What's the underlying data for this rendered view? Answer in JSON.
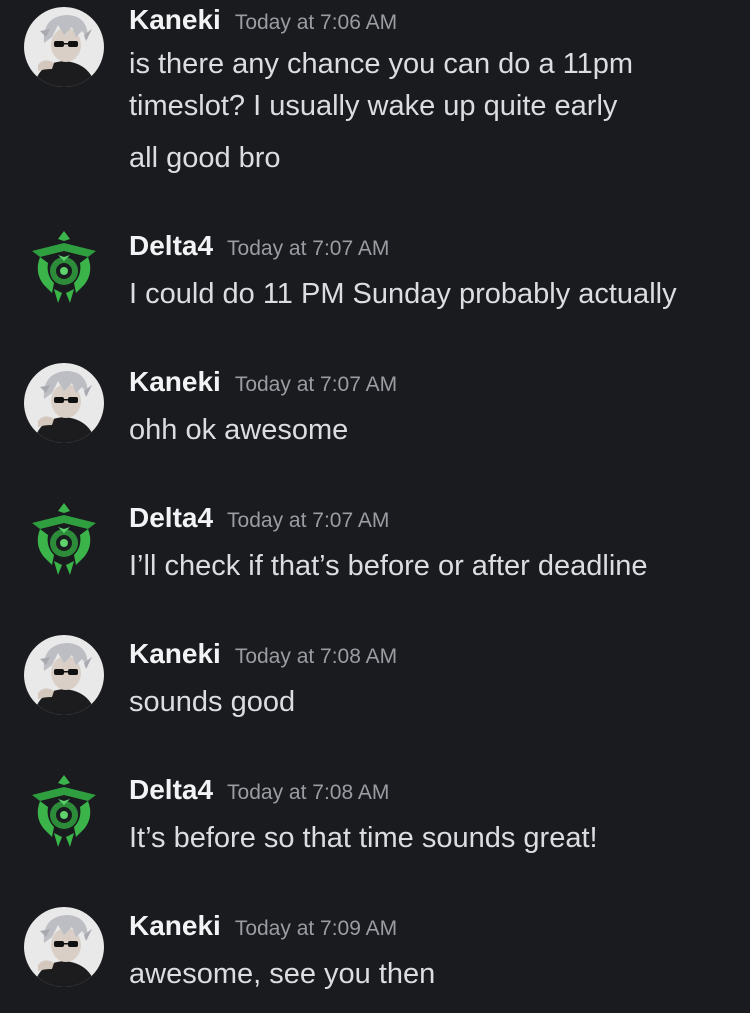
{
  "messages": [
    {
      "author": "Kaneki",
      "avatar": "kaneki-avatar",
      "timestamp": "Today at 7:06 AM",
      "lines": [
        "is there any chance you can do a 11pm",
        "timeslot? I usually wake up quite early",
        "all good bro"
      ]
    },
    {
      "author": "Delta4",
      "avatar": "delta4-avatar",
      "timestamp": "Today at 7:07 AM",
      "lines": [
        "I could do 11 PM Sunday probably actually"
      ]
    },
    {
      "author": "Kaneki",
      "avatar": "kaneki-avatar",
      "timestamp": "Today at 7:07 AM",
      "lines": [
        "ohh ok awesome"
      ]
    },
    {
      "author": "Delta4",
      "avatar": "delta4-avatar",
      "timestamp": "Today at 7:07 AM",
      "lines": [
        "I’ll check if that’s before or after deadline"
      ]
    },
    {
      "author": "Kaneki",
      "avatar": "kaneki-avatar",
      "timestamp": "Today at 7:08 AM",
      "lines": [
        "sounds good"
      ]
    },
    {
      "author": "Delta4",
      "avatar": "delta4-avatar",
      "timestamp": "Today at 7:08 AM",
      "lines": [
        "It’s before so that time sounds great!"
      ]
    },
    {
      "author": "Kaneki",
      "avatar": "kaneki-avatar",
      "timestamp": "Today at 7:09 AM",
      "lines": [
        "awesome, see you then"
      ]
    }
  ],
  "colors": {
    "background": "#1a1b1e",
    "author": "#f2f3f5",
    "timestamp": "#9a9ca3",
    "text": "#dcdde1",
    "delta_avatar_green": "#3bb54a"
  }
}
